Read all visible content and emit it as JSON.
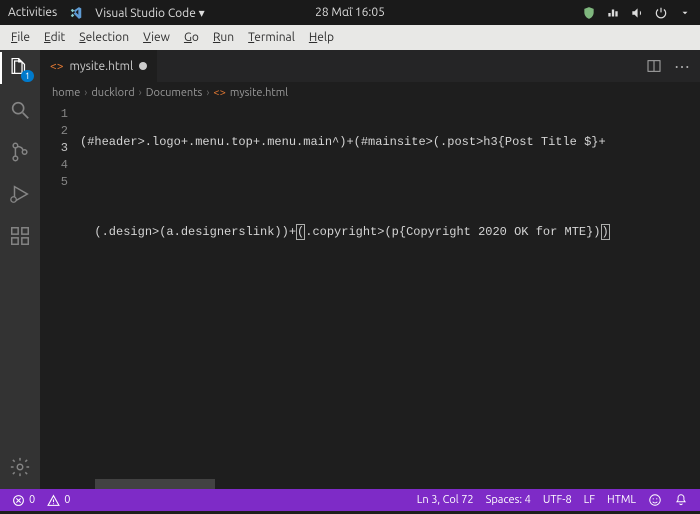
{
  "topbar": {
    "activities": "Activities",
    "appname": "Visual Studio Code ▾",
    "datetime": "28 Μαΐ  16:05"
  },
  "menubar": {
    "file": "File",
    "edit": "Edit",
    "selection": "Selection",
    "view": "View",
    "go": "Go",
    "run": "Run",
    "terminal": "Terminal",
    "help": "Help"
  },
  "activitybar": {
    "explorer_badge": "1"
  },
  "tab": {
    "filename": "mysite.html"
  },
  "tabactions": {},
  "breadcrumb": {
    "home": "home",
    "user": "ducklord",
    "docs": "Documents",
    "file": "mysite.html"
  },
  "editor": {
    "lines": [
      "1",
      "2",
      "3",
      "4",
      "5"
    ],
    "line1": "(#header>.logo+.menu.top+.menu.main^)+(#mainsite>(.post>h3{Post Title $}+",
    "line3a": "(.design>(a.designerslink))+",
    "line3b": "(",
    "line3c": ".copyright>(p{Copyright 2020 OK for MTE})",
    "line3d": ")"
  },
  "status": {
    "errors": "0",
    "warnings": "0",
    "lncol": "Ln 3, Col 72",
    "spaces": "Spaces: 4",
    "encoding": "UTF-8",
    "eol": "LF",
    "lang": "HTML",
    "bell": "",
    "smile": ""
  },
  "icons": {
    "vscode": "vscode",
    "shield": "shield",
    "net": "net",
    "speaker": "speaker",
    "power": "power",
    "dropdown": "dropdown"
  }
}
